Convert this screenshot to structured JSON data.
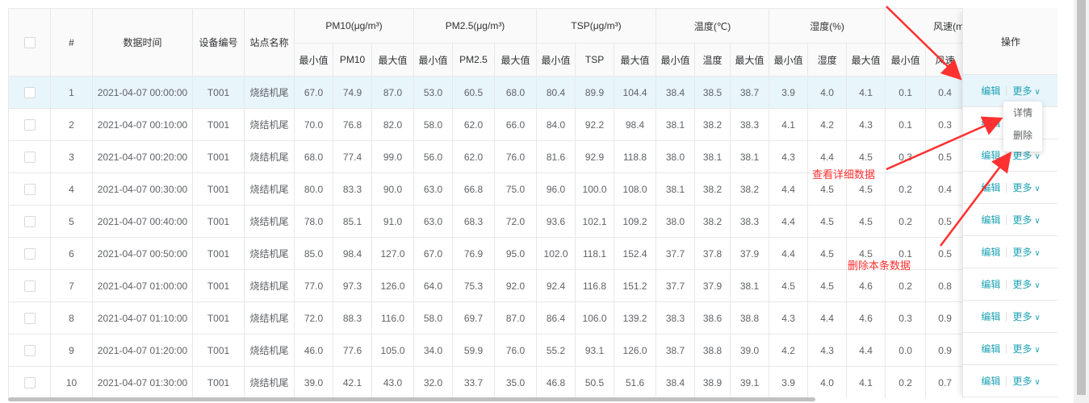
{
  "header": {
    "index": "#",
    "time": "数据时间",
    "device": "设备编号",
    "station": "站点名称",
    "groups": [
      "PM10(μg/m³)",
      "PM2.5(μg/m³)",
      "TSP(μg/m³)",
      "温度(℃)",
      "湿度(%)",
      "风速(m"
    ],
    "subs": [
      "最小值",
      "PM10",
      "最大值",
      "最小值",
      "PM2.5",
      "最大值",
      "最小值",
      "TSP",
      "最大值",
      "最小值",
      "温度",
      "最大值",
      "最小值",
      "湿度",
      "最大值",
      "最小值",
      "风速"
    ],
    "action": "操作"
  },
  "rows": [
    [
      "1",
      "2021-04-07 00:00:00",
      "T001",
      "烧结机尾",
      "67.0",
      "74.9",
      "87.0",
      "53.0",
      "60.5",
      "68.0",
      "80.4",
      "89.9",
      "104.4",
      "38.4",
      "38.5",
      "38.7",
      "3.9",
      "4.0",
      "4.1",
      "0.1",
      "0.4"
    ],
    [
      "2",
      "2021-04-07 00:10:00",
      "T001",
      "烧结机尾",
      "70.0",
      "76.8",
      "82.0",
      "58.0",
      "62.0",
      "66.0",
      "84.0",
      "92.2",
      "98.4",
      "38.1",
      "38.2",
      "38.3",
      "4.1",
      "4.2",
      "4.3",
      "0.1",
      "0.3"
    ],
    [
      "3",
      "2021-04-07 00:20:00",
      "T001",
      "烧结机尾",
      "68.0",
      "77.4",
      "99.0",
      "56.0",
      "62.0",
      "76.0",
      "81.6",
      "92.9",
      "118.8",
      "38.0",
      "38.1",
      "38.1",
      "4.3",
      "4.4",
      "4.5",
      "0.3",
      "0.5"
    ],
    [
      "4",
      "2021-04-07 00:30:00",
      "T001",
      "烧结机尾",
      "80.0",
      "83.3",
      "90.0",
      "63.0",
      "66.8",
      "75.0",
      "96.0",
      "100.0",
      "108.0",
      "38.1",
      "38.2",
      "38.2",
      "4.4",
      "4.5",
      "4.5",
      "0.2",
      "0.4"
    ],
    [
      "5",
      "2021-04-07 00:40:00",
      "T001",
      "烧结机尾",
      "78.0",
      "85.1",
      "91.0",
      "63.0",
      "68.3",
      "72.0",
      "93.6",
      "102.1",
      "109.2",
      "38.0",
      "38.2",
      "38.3",
      "4.4",
      "4.5",
      "4.5",
      "0.2",
      "0.5"
    ],
    [
      "6",
      "2021-04-07 00:50:00",
      "T001",
      "烧结机尾",
      "85.0",
      "98.4",
      "127.0",
      "67.0",
      "76.9",
      "95.0",
      "102.0",
      "118.1",
      "152.4",
      "37.7",
      "37.8",
      "37.9",
      "4.4",
      "4.5",
      "4.5",
      "0.1",
      "0.5"
    ],
    [
      "7",
      "2021-04-07 01:00:00",
      "T001",
      "烧结机尾",
      "77.0",
      "97.3",
      "126.0",
      "64.0",
      "75.3",
      "92.0",
      "92.4",
      "116.8",
      "151.2",
      "37.7",
      "37.9",
      "38.1",
      "4.5",
      "4.5",
      "4.6",
      "0.2",
      "0.8"
    ],
    [
      "8",
      "2021-04-07 01:10:00",
      "T001",
      "烧结机尾",
      "72.0",
      "88.3",
      "116.0",
      "58.0",
      "69.7",
      "87.0",
      "86.4",
      "106.0",
      "139.2",
      "38.3",
      "38.6",
      "38.8",
      "4.3",
      "4.4",
      "4.6",
      "0.3",
      "0.9"
    ],
    [
      "9",
      "2021-04-07 01:20:00",
      "T001",
      "烧结机尾",
      "46.0",
      "77.6",
      "105.0",
      "34.0",
      "59.9",
      "76.0",
      "55.2",
      "93.1",
      "126.0",
      "38.7",
      "38.8",
      "39.0",
      "4.2",
      "4.3",
      "4.4",
      "0.0",
      "0.9"
    ],
    [
      "10",
      "2021-04-07 01:30:00",
      "T001",
      "烧结机尾",
      "39.0",
      "42.1",
      "43.0",
      "32.0",
      "33.7",
      "35.0",
      "46.8",
      "50.5",
      "51.6",
      "38.4",
      "38.9",
      "39.1",
      "3.9",
      "4.0",
      "4.1",
      "0.2",
      "0.7"
    ]
  ],
  "actions": {
    "edit": "编辑",
    "more": "更多"
  },
  "dropdown": {
    "detail": "详情",
    "delete": "删除"
  },
  "annotations": {
    "view_detail": "查看详细数据",
    "delete_row": "删除本条数据"
  },
  "colors": {
    "accent": "#1fa3b5",
    "selected_row": "#e8f5fb",
    "annotation": "#ff3030"
  }
}
